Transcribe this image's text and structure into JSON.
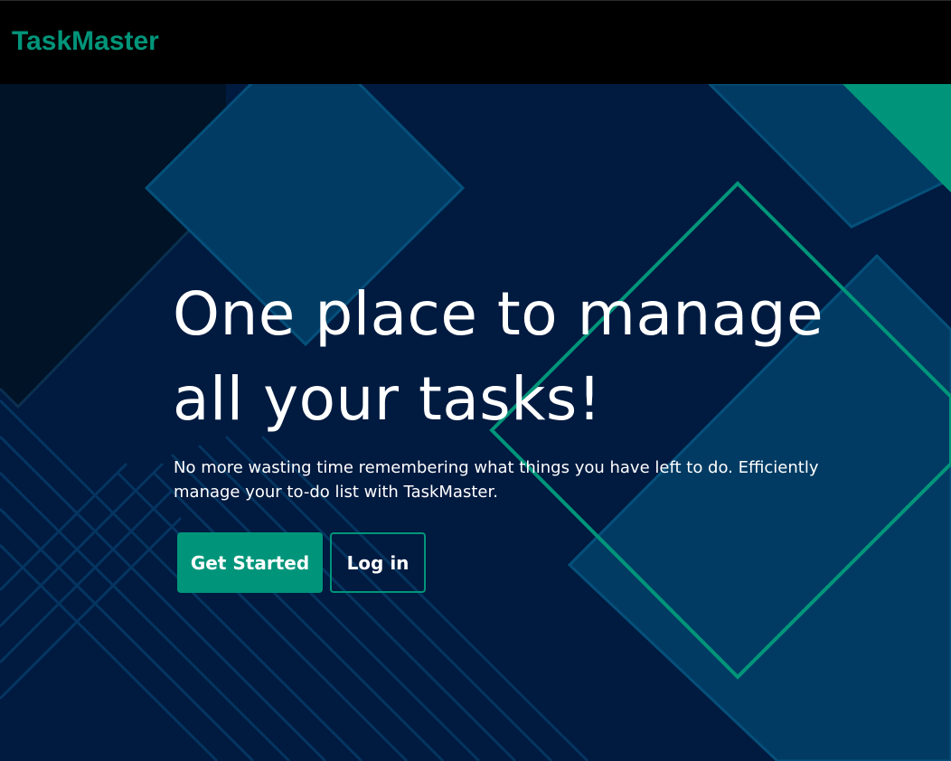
{
  "navbar": {
    "brand": "TaskMaster"
  },
  "hero": {
    "headline_line1": "One place to manage",
    "headline_line2": "all your tasks!",
    "subtext_line1": "No more wasting time remembering what things you have left to do. Efficiently",
    "subtext_line2": "manage your to-do list with TaskMaster.",
    "primary_button": "Get Started",
    "secondary_button": "Log in"
  },
  "colors": {
    "accent": "#00957a",
    "background": "#001a40",
    "navbar": "#000000",
    "text": "#ffffff"
  }
}
